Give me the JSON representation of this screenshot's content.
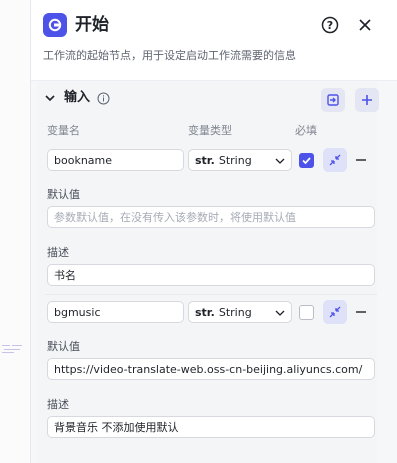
{
  "panel": {
    "title": "开始",
    "description": "工作流的起始节点，用于设定启动工作流需要的信息"
  },
  "section": {
    "title": "输入"
  },
  "columns": {
    "name": "变量名",
    "type": "变量类型",
    "required": "必填"
  },
  "params": [
    {
      "name": "bookname",
      "type_prefix": "str.",
      "type_label": "String",
      "required": true,
      "default_label": "默认值",
      "default_value": "",
      "default_placeholder": "参数默认值，在没有传入该参数时，将使用默认值",
      "desc_label": "描述",
      "desc_value": "书名"
    },
    {
      "name": "bgmusic",
      "type_prefix": "str.",
      "type_label": "String",
      "required": false,
      "default_label": "默认值",
      "default_value": "https://video-translate-web.oss-cn-beijing.aliyuncs.com/",
      "default_placeholder": "",
      "desc_label": "描述",
      "desc_value": "背景音乐 不添加使用默认"
    }
  ],
  "colors": {
    "accent": "#4d53e8",
    "panel_bg": "#f6f7f9"
  },
  "icons": [
    "workflow-start-icon",
    "help-icon",
    "close-icon",
    "chevron-down-icon",
    "info-icon",
    "import-icon",
    "plus-icon",
    "check-icon",
    "collapse-icon",
    "minus-icon",
    "caret-down-icon"
  ]
}
